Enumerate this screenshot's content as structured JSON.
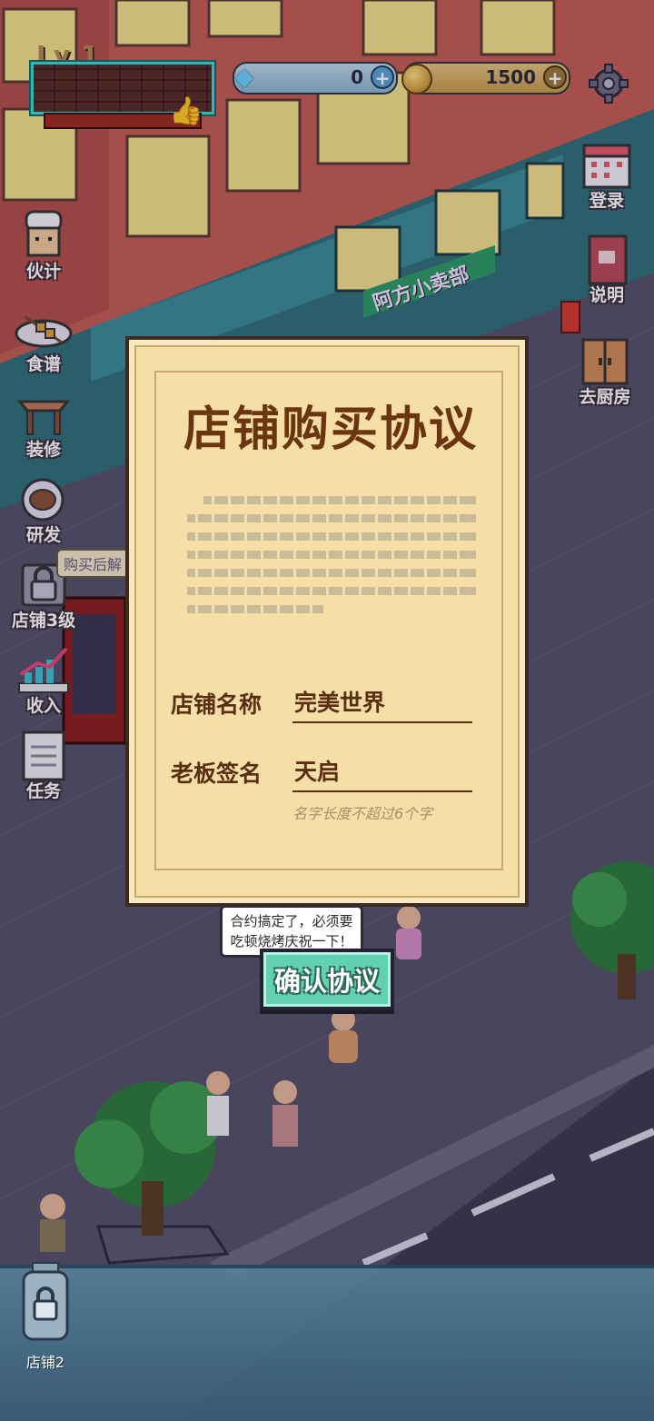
{
  "hud": {
    "level": "Lv 1",
    "gems": "0",
    "gold": "1500"
  },
  "left_menu": [
    {
      "label": "伙计",
      "icon": "chef-hat-icon"
    },
    {
      "label": "食谱",
      "icon": "skewer-plate-icon"
    },
    {
      "label": "装修",
      "icon": "table-icon"
    },
    {
      "label": "研发",
      "icon": "meat-research-icon"
    },
    {
      "label": "店铺3级",
      "icon": "lock-icon"
    },
    {
      "label": "收入",
      "icon": "chart-up-icon"
    },
    {
      "label": "任务",
      "icon": "notepad-icon"
    }
  ],
  "lock_tag": "购买后解",
  "right_menu": [
    {
      "label": "登录",
      "icon": "calendar-icon"
    },
    {
      "label": "说明",
      "icon": "book-icon"
    },
    {
      "label": "去厨房",
      "icon": "door-icon"
    }
  ],
  "shop_sign": "阿方小卖部",
  "contract": {
    "title": "店铺购买协议",
    "store_name_label": "店铺名称",
    "store_name_value": "完美世界",
    "boss_sign_label": "老板签名",
    "boss_sign_value": "天启",
    "hint": "名字长度不超过6个字"
  },
  "speech": "合约搞定了，必须要吃顿烧烤庆祝一下！",
  "confirm_button": "确认协议",
  "bottom": {
    "shop2_label": "店铺2"
  },
  "colors": {
    "contract_paper": "#f5dfa6",
    "title_brown": "#6b3511",
    "confirm_green": "#62d1b0",
    "hud_cyan": "#3ed9d9"
  }
}
